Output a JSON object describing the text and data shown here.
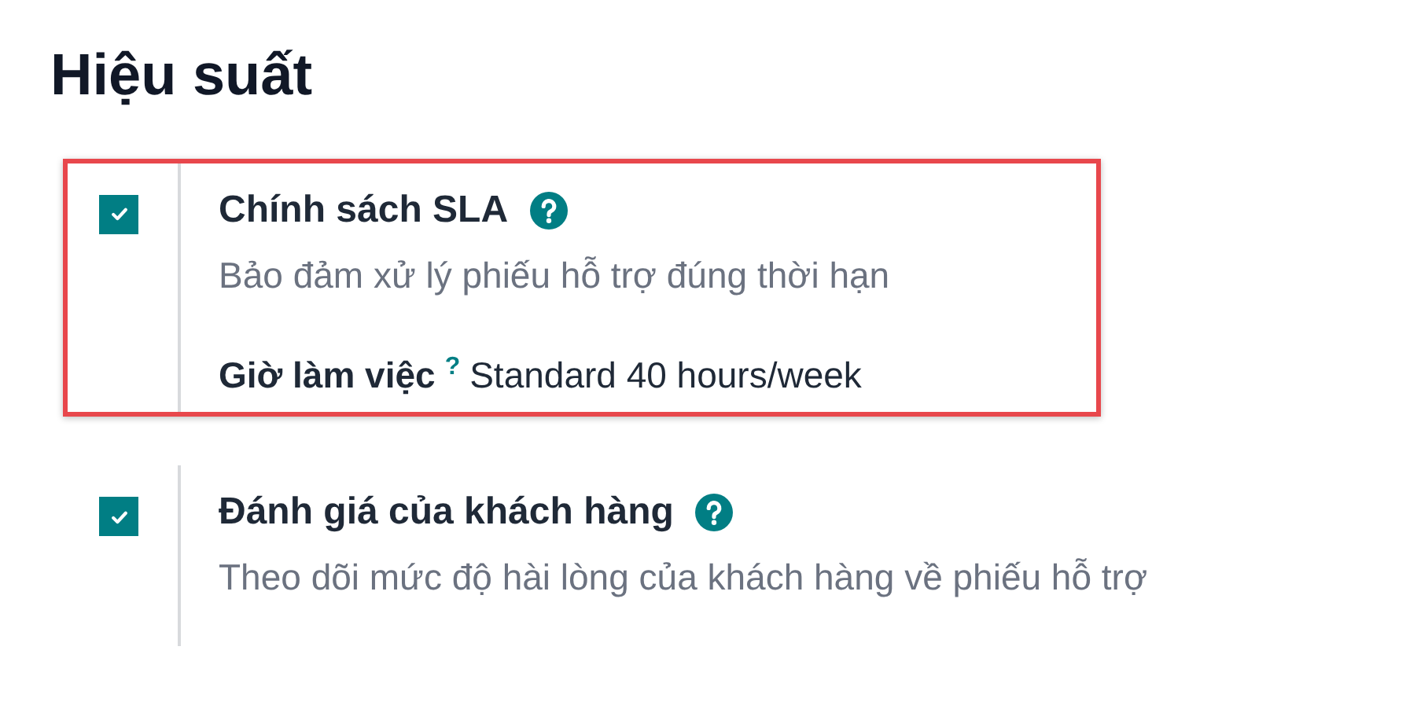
{
  "section_title": "Hiệu suất",
  "settings": [
    {
      "label": "Chính sách SLA",
      "checked": true,
      "highlighted": true,
      "description": "Bảo đảm xử lý phiếu hỗ trợ đúng thời hạn",
      "field": {
        "label": "Giờ làm việc",
        "tooltip_mark": "?",
        "value": "Standard 40 hours/week"
      }
    },
    {
      "label": "Đánh giá của khách hàng",
      "checked": true,
      "highlighted": false,
      "description": "Theo dõi mức độ hài lòng của khách hàng về phiếu hỗ trợ"
    }
  ]
}
